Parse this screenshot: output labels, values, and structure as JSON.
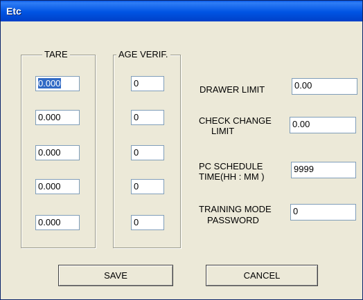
{
  "window": {
    "title": "Etc"
  },
  "tare": {
    "legend": "TARE",
    "values": [
      "0.000",
      "0.000",
      "0.000",
      "0.000",
      "0.000"
    ]
  },
  "age_verif": {
    "legend": "AGE VERIF.",
    "values": [
      "0",
      "0",
      "0",
      "0",
      "0"
    ]
  },
  "settings": {
    "drawer_limit": {
      "label": "DRAWER  LIMIT",
      "value": "0.00"
    },
    "check_change_limit": {
      "label_line1": "CHECK CHANGE",
      "label_line2": "LIMIT",
      "value": "0.00"
    },
    "pc_schedule_time": {
      "label_line1": "PC SCHEDULE",
      "label_line2": "TIME(HH : MM )",
      "value": "9999"
    },
    "training_mode_password": {
      "label_line1": "TRAINING MODE",
      "label_line2": "PASSWORD",
      "value": "0"
    }
  },
  "buttons": {
    "save": "SAVE",
    "cancel": "CANCEL"
  },
  "colors": {
    "titlebar": "#0054E3",
    "dialog_bg": "#ECE9D8",
    "selection": "#316AC5"
  }
}
